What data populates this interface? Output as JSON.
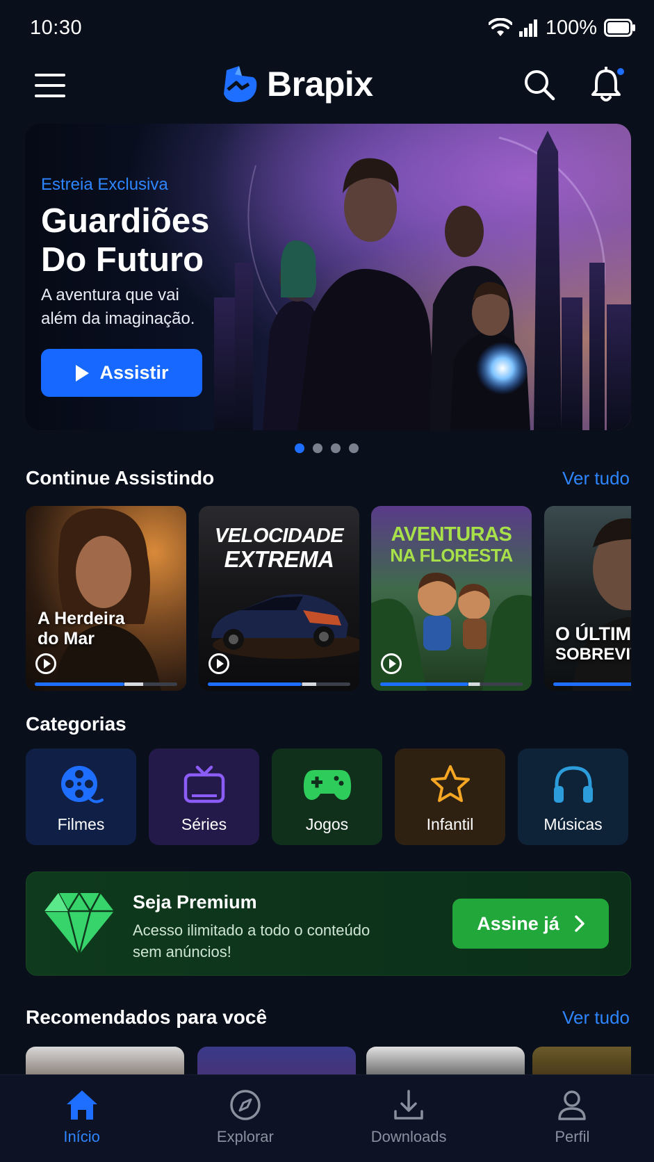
{
  "status_bar": {
    "time": "10:30",
    "battery": "100%"
  },
  "app": {
    "name": "Brapix"
  },
  "colors": {
    "accent": "#1e6eff",
    "link": "#2e86ff",
    "premium_green": "#22a83a",
    "background": "#0a0f1c"
  },
  "hero": {
    "kicker": "Estreia Exclusiva",
    "title_line1": "Guardiões",
    "title_line2": "Do Futuro",
    "subtitle_line1": "A aventura que vai",
    "subtitle_line2": "além da imaginação.",
    "button_label": "Assistir",
    "carousel_pages": 4,
    "carousel_active_index": 0
  },
  "continue_watching": {
    "title": "Continue Assistindo",
    "see_all": "Ver tudo",
    "items": [
      {
        "title_line1": "A Herdeira",
        "title_line2": "do Mar",
        "progress": 0.63,
        "buffered": 0.76
      },
      {
        "title_line1": "VELOCIDADE",
        "title_line2": "EXTREMA",
        "progress": 0.66,
        "buffered": 0.76
      },
      {
        "title_line1": "AVENTURAS",
        "title_line2": "NA FLORESTA",
        "progress": 0.62,
        "buffered": 0.7
      },
      {
        "title_line1": "O ÚLTIM",
        "title_line2": "SOBREVIV",
        "progress": 1.0,
        "buffered": 1.0
      }
    ]
  },
  "categories": {
    "title": "Categorias",
    "items": [
      {
        "label": "Filmes",
        "icon": "film-reel-icon",
        "bg": "#0f1f45",
        "color": "#1e6eff"
      },
      {
        "label": "Séries",
        "icon": "tv-icon",
        "bg": "#231a4a",
        "color": "#8b5cf6"
      },
      {
        "label": "Jogos",
        "icon": "gamepad-icon",
        "bg": "#11301c",
        "color": "#2ecc5a"
      },
      {
        "label": "Infantil",
        "icon": "star-icon",
        "bg": "#2e2112",
        "color": "#f5a623"
      },
      {
        "label": "Músicas",
        "icon": "headphones-icon",
        "bg": "#0e2238",
        "color": "#2d9cdb"
      }
    ]
  },
  "premium": {
    "title": "Seja Premium",
    "subtitle_line1": "Acesso ilimitado a todo o conteúdo",
    "subtitle_line2": "sem anúncios!",
    "button_label": "Assine já"
  },
  "recommended": {
    "title": "Recomendados para você",
    "see_all": "Ver tudo"
  },
  "bottom_nav": {
    "items": [
      {
        "label": "Início",
        "icon": "home-icon",
        "active": true
      },
      {
        "label": "Explorar",
        "icon": "compass-icon",
        "active": false
      },
      {
        "label": "Downloads",
        "icon": "download-icon",
        "active": false
      },
      {
        "label": "Perfil",
        "icon": "user-icon",
        "active": false
      }
    ]
  }
}
